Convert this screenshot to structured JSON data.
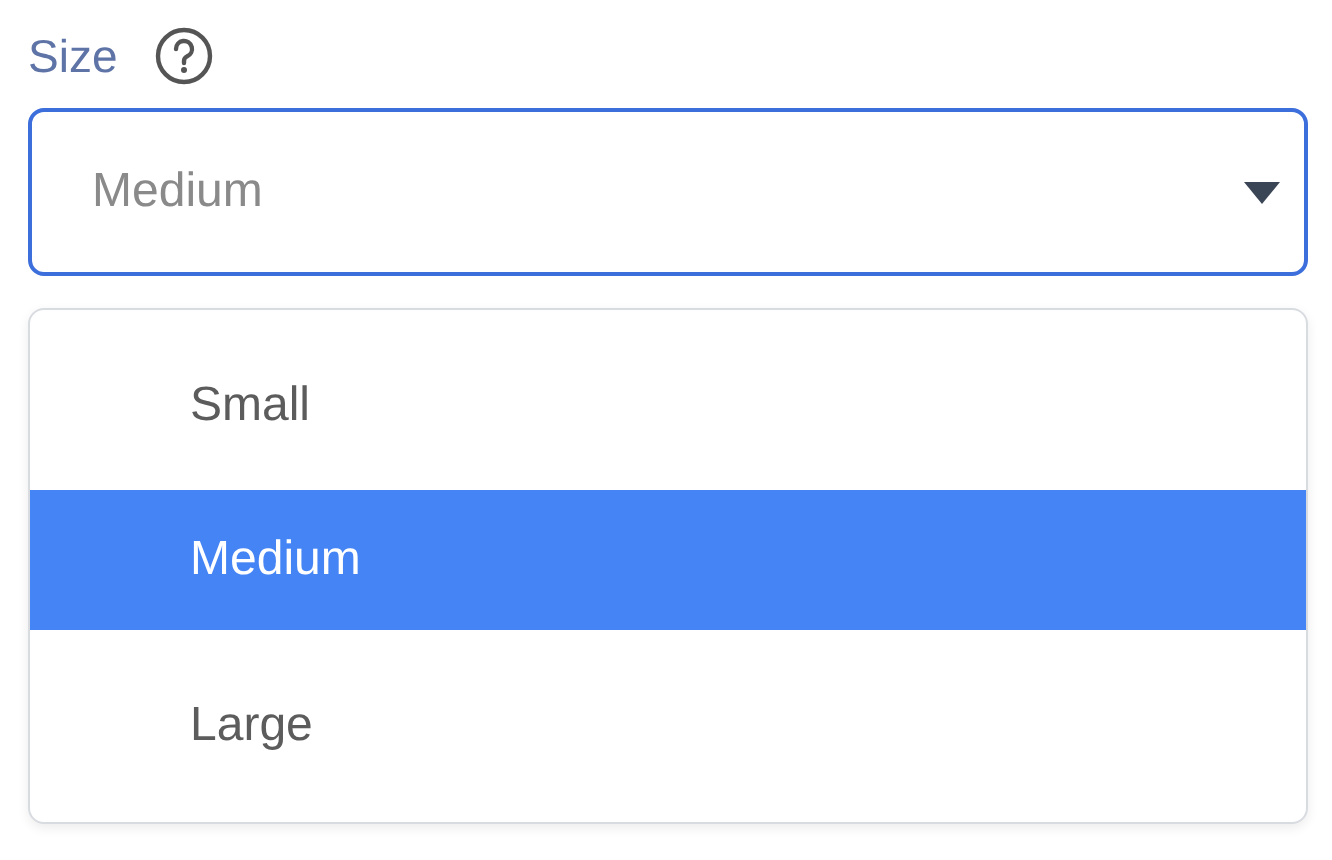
{
  "field": {
    "label": "Size",
    "placeholder": "Medium",
    "focused": true
  },
  "options": [
    {
      "label": "Small",
      "selected": false
    },
    {
      "label": "Medium",
      "selected": true
    },
    {
      "label": "Large",
      "selected": false
    }
  ]
}
